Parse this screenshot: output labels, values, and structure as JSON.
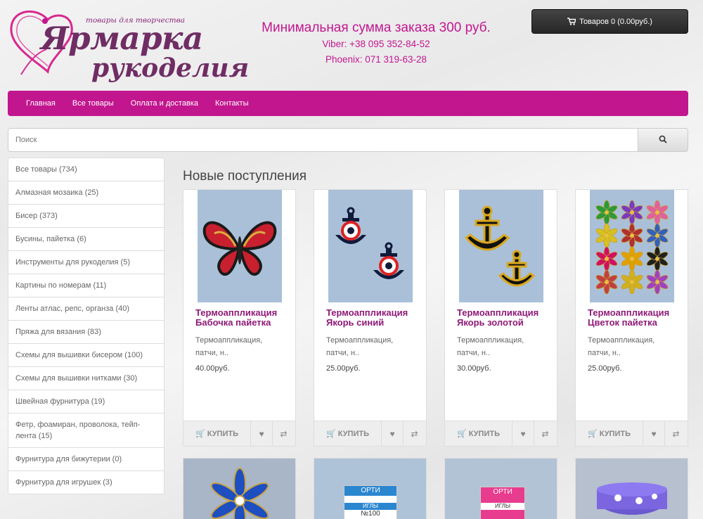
{
  "header": {
    "logo_title_1": "Ярмарка",
    "logo_title_2": "рукоделия",
    "logo_tagline": "товары для творчества",
    "min_order": "Минимальная сумма заказа 300 руб.",
    "viber": "Viber: +38 095 352-84-52",
    "phoenix": "Phoenix: 071 319-63-28",
    "cart_label": "Товаров 0 (0.00руб.)",
    "cart_icon": "shopping-cart-icon"
  },
  "menu": [
    "Главная",
    "Все товары",
    "Оплата и доставка",
    "Контакты"
  ],
  "search": {
    "placeholder": "Поиск",
    "button_icon": "search-icon"
  },
  "categories": [
    "Все товары (734)",
    "Алмазная мозаика (25)",
    "Бисер (373)",
    "Бусины, пайетка (6)",
    "Инструменты для рукоделия (5)",
    "Картины по номерам (11)",
    "Ленты атлас, репс, органза (40)",
    "Пряжа для вязания (83)",
    "Схемы для вышивки бисером (100)",
    "Схемы для вышивки нитками (30)",
    "Швейная фурнитура (19)",
    "Фетр, фоамиран, проволока, тейп-лента (15)",
    "Фурнитура для бижутерии (0)",
    "Фурнитура для игрушек (3)"
  ],
  "section_title": "Новые поступления",
  "products": [
    {
      "title": "Термоаппликация Бабочка пайетка",
      "desc": "Термоаппликация, патчи, н..",
      "price": "40.00руб."
    },
    {
      "title": "Термоаппликация Якорь синий",
      "desc": "Термоаппликация, патчи, н..",
      "price": "25.00руб."
    },
    {
      "title": "Термоаппликация Якорь золотой",
      "desc": "Термоаппликация, патчи, н..",
      "price": "30.00руб."
    },
    {
      "title": "Термоаппликация Цветок пайетка",
      "desc": "Термоаппликация, патчи, н..",
      "price": "25.00руб."
    }
  ],
  "buy_label": "КУПИТЬ",
  "action_icons": [
    "cart-icon",
    "heart-icon",
    "compare-icon"
  ],
  "second_row": {
    "package_brand": "ОРТИ",
    "package_label": "ИГЛЫ",
    "package_number": "№100"
  },
  "colors": {
    "accent": "#c2168e",
    "title": "#8e1977",
    "logo": "#6f2d64"
  }
}
